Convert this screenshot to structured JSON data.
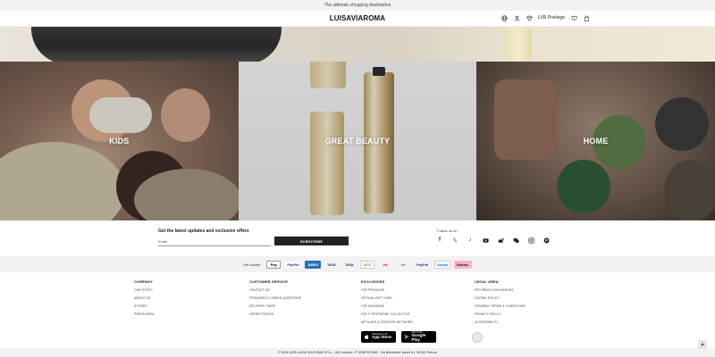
{
  "topbar": {
    "text": "The ultimate shopping destination"
  },
  "header": {
    "logo": "LUISAVIAROMA",
    "icons": [
      "globe-icon",
      "user-icon",
      "diamond-icon",
      "heart-icon",
      "shopping-bag-icon"
    ],
    "program_label": "LVR Privilege"
  },
  "categories": [
    {
      "label": "KIDS"
    },
    {
      "label": "GREAT BEAUTY"
    },
    {
      "label": "HOME"
    }
  ],
  "newsletter": {
    "title": "Get the latest updates and exclusive offers",
    "email_label": "Email",
    "subscribe_label": "SUBSCRIBE"
  },
  "social": {
    "follow_label": "Follow us on",
    "icons": [
      "facebook-icon",
      "x-icon",
      "tiktok-icon",
      "youtube-icon",
      "weibo-icon",
      "wechat-icon",
      "instagram-icon",
      "pinterest-icon"
    ]
  },
  "payments": {
    "label": "We Accept",
    "methods": [
      {
        "name": "Apple Pay",
        "text": "Pay",
        "bg": "#ffffff",
        "fg": "#000000",
        "border": "#999999"
      },
      {
        "name": "PayPal",
        "text": "PayPal",
        "bg": "#ffffff",
        "fg": "#1a3e8c",
        "border": "#f2f2f2"
      },
      {
        "name": "American Express",
        "text": "AMEX",
        "bg": "#2671b9",
        "fg": "#ffffff",
        "border": "#2671b9"
      },
      {
        "name": "Visa",
        "text": "VISA",
        "bg": "#f2f2f2",
        "fg": "#1a1f71",
        "border": "#f2f2f2"
      },
      {
        "name": "Visa Electron",
        "text": "VISA",
        "bg": "#f2f2f2",
        "fg": "#1a1f71",
        "border": "#f2f2f2"
      },
      {
        "name": "Discover",
        "text": "DISC",
        "bg": "#ffffff",
        "fg": "#e07a1f",
        "border": "#cccccc"
      },
      {
        "name": "Mastercard",
        "text": "●●",
        "bg": "#f2f2f2",
        "fg": "#eb001b",
        "border": "#f2f2f2"
      },
      {
        "name": "Maestro",
        "text": "●●",
        "bg": "#f2f2f2",
        "fg": "#0099df",
        "border": "#f2f2f2"
      },
      {
        "name": "PayPal",
        "text": "PayPal",
        "bg": "#f2f2f2",
        "fg": "#1a3e8c",
        "border": "#f2f2f2"
      },
      {
        "name": "Alipay",
        "text": "Alipay",
        "bg": "#ffffff",
        "fg": "#1677ff",
        "border": "#cccccc"
      },
      {
        "name": "Klarna",
        "text": "Klarna.",
        "bg": "#ffb3c7",
        "fg": "#111111",
        "border": "#ffb3c7"
      }
    ]
  },
  "footer": {
    "columns": [
      {
        "title": "COMPANY",
        "links": [
          "OUR STORY",
          "ABOUT US",
          "STORES",
          "PRESS AREA"
        ]
      },
      {
        "title": "CUSTOMER SERVICE",
        "links": [
          "CONTACT US",
          "FREQUENTLY ASKED QUESTIONS",
          "DELIVERY TIMES",
          "ORDER STATUS"
        ]
      },
      {
        "title": "EXCLUSIVES",
        "links": [
          "LVR PRIVILEGE",
          "VIRTUAL GIFT CARD",
          "LVR MAGAZINE",
          "LVR X TESTIMONE COLLECTIVE",
          "AFFILIATE & CREATOR NETWORK"
        ]
      },
      {
        "title": "LEGAL AREA",
        "links": [
          "RETURNS & EXCHANGES",
          "COOKIE POLICY",
          "GENERAL TERMS & CONDITIONS",
          "PRIVACY POLICY",
          "ACCESSIBILITY"
        ]
      }
    ],
    "app_store": {
      "small": "Download on the",
      "big": "App Store"
    },
    "google_play": {
      "small": "GET IT ON",
      "big": "Google Play"
    }
  },
  "copyright": "© 2004-2025 LUISA VIA ROMA S.P.A. - VAT number: IT 00987870480 - Via Benedetto Varchi 61, 50132 Firenze",
  "back_to_top_icon": "arrow-up-icon"
}
